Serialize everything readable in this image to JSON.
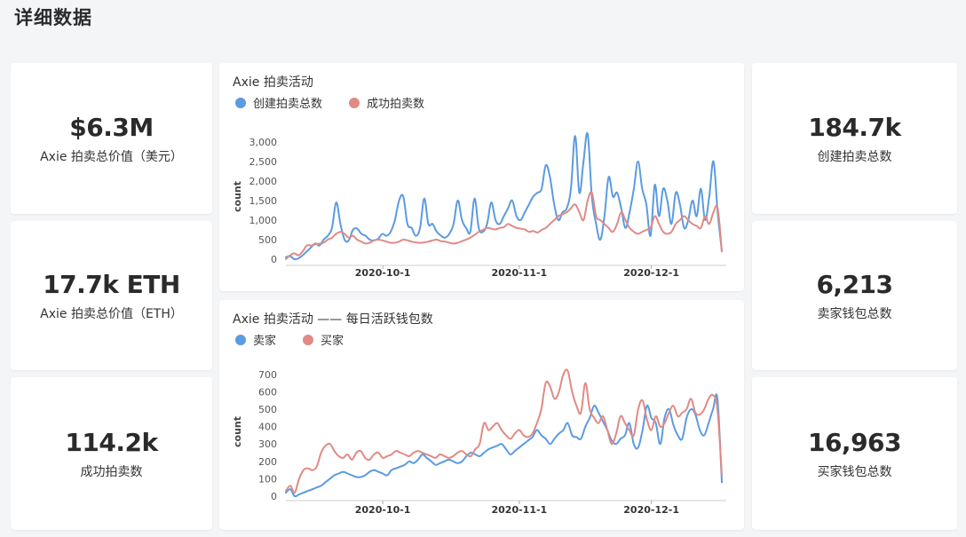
{
  "page": {
    "title": "详细数据"
  },
  "stats": {
    "total_value_usd": {
      "value": "$6.3M",
      "label": "Axie 拍卖总价值（美元）"
    },
    "total_value_eth": {
      "value": "17.7k ETH",
      "label": "Axie 拍卖总价值（ETH）"
    },
    "successful_auctions": {
      "value": "114.2k",
      "label": "成功拍卖数"
    },
    "created_auctions": {
      "value": "184.7k",
      "label": "创建拍卖总数"
    },
    "seller_wallets": {
      "value": "6,213",
      "label": "卖家钱包总数"
    },
    "buyer_wallets": {
      "value": "16,963",
      "label": "买家钱包总数"
    }
  },
  "colors": {
    "blue": "#5b9be0",
    "red": "#e08a85",
    "axis": "#cccccc"
  },
  "chart_data": [
    {
      "type": "line",
      "title": "Axie 拍卖活动",
      "ylabel": "count",
      "xlabel": "",
      "ylim": [
        0,
        3200
      ],
      "yticks": [
        0,
        500,
        1000,
        1500,
        2000,
        2500,
        3000
      ],
      "ytick_labels": [
        "0",
        "500",
        "1,000",
        "1,500",
        "2,000",
        "2,500",
        "3,000"
      ],
      "x_range": [
        0,
        99
      ],
      "xticks": [
        {
          "x": 22,
          "label": "2020-10-1"
        },
        {
          "x": 53,
          "label": "2020-11-1"
        },
        {
          "x": 83,
          "label": "2020-12-1"
        }
      ],
      "series": [
        {
          "name": "创建拍卖总数",
          "color": "#5b9be0",
          "values": [
            50,
            80,
            0,
            20,
            100,
            200,
            300,
            400,
            350,
            500,
            600,
            800,
            1450,
            900,
            500,
            480,
            750,
            780,
            650,
            600,
            500,
            480,
            520,
            650,
            600,
            700,
            1000,
            1500,
            1600,
            900,
            800,
            600,
            800,
            1550,
            900,
            900,
            700,
            600,
            550,
            650,
            900,
            1500,
            1000,
            800,
            700,
            1550,
            800,
            700,
            900,
            1450,
            1000,
            900,
            1100,
            1300,
            1500,
            1100,
            1000,
            1200,
            1400,
            1600,
            1700,
            1800,
            2400,
            2100,
            1400,
            1000,
            1200,
            1300,
            1800,
            3150,
            1700,
            2500,
            3200,
            1600,
            900,
            500,
            1100,
            2100,
            1600,
            1700,
            1300,
            800,
            1200,
            1800,
            2500,
            1800,
            1400,
            600,
            1900,
            1100,
            1800,
            1500,
            900,
            1700,
            1400,
            800,
            1000,
            1500,
            1100,
            1800,
            1000,
            1600,
            2500,
            1200,
            200
          ],
          "note_values_trimmed": true
        },
        {
          "name": "成功拍卖数",
          "color": "#e08a85",
          "values": [
            0,
            100,
            150,
            100,
            200,
            350,
            350,
            380,
            400,
            420,
            500,
            550,
            650,
            700,
            650,
            550,
            600,
            500,
            450,
            400,
            420,
            480,
            500,
            480,
            450,
            420,
            420,
            450,
            500,
            480,
            450,
            430,
            420,
            430,
            450,
            480,
            500,
            460,
            450,
            420,
            400,
            420,
            460,
            500,
            550,
            620,
            700,
            750,
            800,
            780,
            760,
            800,
            820,
            900,
            850,
            800,
            780,
            760,
            700,
            720,
            680,
            750,
            800,
            900,
            1000,
            1100,
            1150,
            1200,
            1300,
            1400,
            1200,
            1000,
            1500,
            1700,
            1100,
            1000,
            900,
            800,
            700,
            900,
            1200,
            1000,
            800,
            700,
            650,
            700,
            750,
            800,
            1100,
            900,
            700,
            650,
            700,
            900,
            1000,
            1100,
            1000,
            900,
            850,
            800,
            1100,
            900,
            1200,
            1300,
            200
          ]
        }
      ]
    },
    {
      "type": "line",
      "title": "Axie 拍卖活动 —— 每日活跃钱包数",
      "ylabel": "count",
      "xlabel": "",
      "ylim": [
        0,
        740
      ],
      "yticks": [
        0,
        100,
        200,
        300,
        400,
        500,
        600,
        700
      ],
      "ytick_labels": [
        "0",
        "100",
        "200",
        "300",
        "400",
        "500",
        "600",
        "700"
      ],
      "x_range": [
        0,
        99
      ],
      "xticks": [
        {
          "x": 22,
          "label": "2020-10-1"
        },
        {
          "x": 53,
          "label": "2020-11-1"
        },
        {
          "x": 83,
          "label": "2020-12-1"
        }
      ],
      "series": [
        {
          "name": "卖家",
          "color": "#5b9be0",
          "values": [
            20,
            40,
            0,
            10,
            20,
            30,
            40,
            50,
            60,
            80,
            100,
            120,
            130,
            140,
            130,
            120,
            110,
            110,
            120,
            140,
            150,
            140,
            130,
            120,
            150,
            160,
            170,
            180,
            200,
            190,
            210,
            240,
            220,
            200,
            180,
            190,
            200,
            210,
            200,
            190,
            200,
            230,
            250,
            240,
            230,
            250,
            270,
            280,
            290,
            300,
            270,
            240,
            260,
            280,
            300,
            320,
            340,
            380,
            350,
            330,
            300,
            330,
            360,
            380,
            420,
            350,
            340,
            330,
            400,
            450,
            520,
            480,
            430,
            380,
            320,
            300,
            330,
            350,
            420,
            300,
            280,
            380,
            520,
            450,
            420,
            300,
            450,
            500,
            410,
            350,
            330,
            450,
            500,
            470,
            380,
            350,
            420,
            500,
            560,
            80
          ],
          "note": "approximate"
        },
        {
          "name": "买家",
          "color": "#e08a85",
          "values": [
            30,
            60,
            20,
            100,
            150,
            160,
            150,
            170,
            250,
            290,
            300,
            260,
            230,
            220,
            240,
            210,
            250,
            260,
            220,
            210,
            240,
            250,
            220,
            230,
            240,
            260,
            250,
            240,
            230,
            250,
            260,
            250,
            240,
            230,
            220,
            240,
            230,
            220,
            230,
            250,
            260,
            240,
            230,
            270,
            300,
            420,
            380,
            400,
            420,
            380,
            350,
            330,
            360,
            380,
            350,
            340,
            360,
            420,
            500,
            650,
            630,
            560,
            600,
            700,
            720,
            600,
            520,
            480,
            650,
            500,
            450,
            420,
            460,
            380,
            300,
            360,
            460,
            420,
            380,
            350,
            500,
            550,
            440,
            380,
            460,
            400,
            420,
            480,
            520,
            460,
            480,
            500,
            560,
            480,
            470,
            500,
            560,
            580,
            500,
            120
          ]
        }
      ]
    }
  ]
}
